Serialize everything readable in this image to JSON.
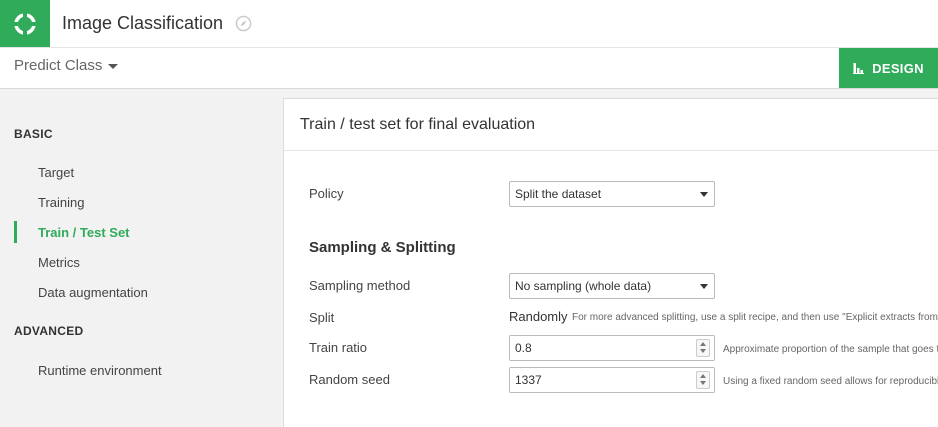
{
  "header": {
    "app_title": "Image Classification",
    "logo_icon": "dataiku-bird-logo",
    "title_icon": "compass-icon",
    "brand_color": "#2fab5a"
  },
  "subbar": {
    "predict_dropdown": "Predict Class",
    "design_button": "DESIGN",
    "design_icon": "flask-icon"
  },
  "sidebar": {
    "basic_heading": "BASIC",
    "basic_items": [
      {
        "label": "Target"
      },
      {
        "label": "Training"
      },
      {
        "label": "Train / Test Set",
        "active": true
      },
      {
        "label": "Metrics"
      },
      {
        "label": "Data augmentation"
      }
    ],
    "advanced_heading": "ADVANCED",
    "advanced_items": [
      {
        "label": "Runtime environment"
      }
    ]
  },
  "main": {
    "card_title": "Train / test set for final evaluation",
    "policy": {
      "label": "Policy",
      "value": "Split the dataset"
    },
    "sampling_heading": "Sampling & Splitting",
    "sampling_method": {
      "label": "Sampling method",
      "value": "No sampling (whole data)"
    },
    "split": {
      "label": "Split",
      "value": "Randomly",
      "hint": "For more advanced splitting, use a split recipe, and then use \"Explicit extracts from tw"
    },
    "train_ratio": {
      "label": "Train ratio",
      "value": "0.8",
      "hint": "Approximate proportion of the sample that goes to"
    },
    "random_seed": {
      "label": "Random seed",
      "value": "1337",
      "hint": "Using a fixed random seed allows for reproducible"
    }
  }
}
